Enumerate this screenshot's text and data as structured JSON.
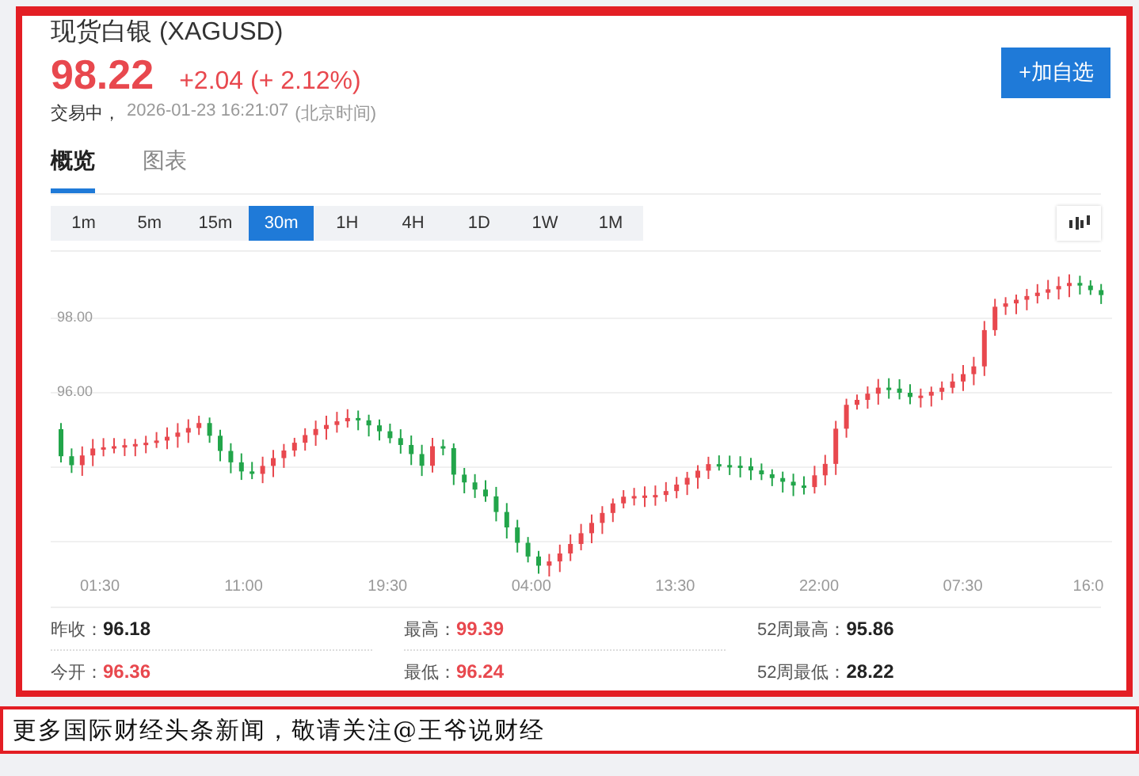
{
  "header": {
    "title": "现货白银  (XAGUSD)",
    "price": "98.22",
    "change": "+2.04 (+ 2.12%)",
    "status": "交易中，",
    "time": "2026-01-23 16:21:07",
    "timezone": "(北京时间)",
    "add_button": "+加自选"
  },
  "tabs": [
    {
      "label": "概览",
      "selected": true
    },
    {
      "label": "图表",
      "selected": false
    }
  ],
  "intervals": [
    {
      "label": "1m",
      "selected": false
    },
    {
      "label": "5m",
      "selected": false
    },
    {
      "label": "15m",
      "selected": false
    },
    {
      "label": "30m",
      "selected": true
    },
    {
      "label": "1H",
      "selected": false
    },
    {
      "label": "4H",
      "selected": false
    },
    {
      "label": "1D",
      "selected": false
    },
    {
      "label": "1W",
      "selected": false
    },
    {
      "label": "1M",
      "selected": false
    }
  ],
  "chart": {
    "y_labels": [
      "98.00",
      "96.00"
    ],
    "x_labels": [
      "01:30",
      "11:00",
      "19:30",
      "04:00",
      "13:30",
      "22:00",
      "07:30",
      "16:0"
    ]
  },
  "stats": [
    {
      "label": "昨收：",
      "value": "96.18",
      "color": "#222222"
    },
    {
      "label": "最高：",
      "value": "99.39",
      "color": "#e8484e"
    },
    {
      "label": "52周最高：",
      "value": "95.86",
      "color": "#222222"
    },
    {
      "label": "今开：",
      "value": "96.36",
      "color": "#e8484e"
    },
    {
      "label": "最低：",
      "value": "96.24",
      "color": "#e8484e"
    },
    {
      "label": "52周最低：",
      "value": "28.22",
      "color": "#222222"
    }
  ],
  "caption": "更多国际财经头条新闻，敬请关注@王爷说财经"
}
